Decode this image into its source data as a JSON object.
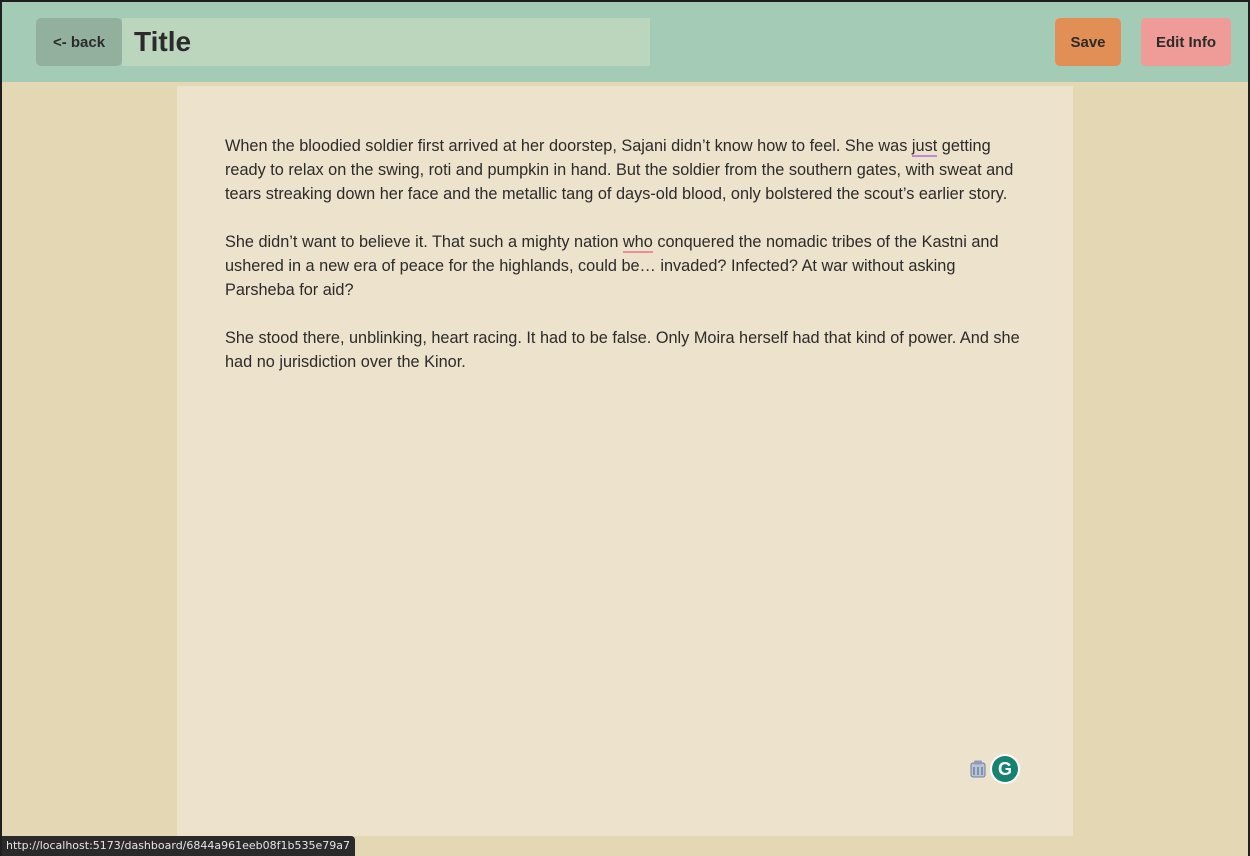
{
  "header": {
    "back_label": "<- back",
    "title_value": "Title",
    "save_label": "Save",
    "edit_info_label": "Edit Info"
  },
  "editor": {
    "p1_a": "When the bloodied soldier first arrived at her doorstep, Sajani didn’t know how to feel. She was ",
    "p1_flag": "just",
    "p1_b": " getting ready to relax on the swing, roti and pumpkin in hand. But the soldier from the southern gates, with sweat and tears streaking down her face and the metallic tang of days-old blood, only bolstered the scout’s earlier story.",
    "p2_a": "She didn’t want to believe it. That such a mighty nation ",
    "p2_flag": "who",
    "p2_b": " conquered the nomadic tribes of the Kastni and ushered in a new era of peace for the highlands, could be… invaded? Infected? At war without asking Parsheba for aid?",
    "p3": "She stood there, unblinking, heart racing. It had to be false. Only Moira herself had that kind of power. And she had no jurisdiction over the Kinor."
  },
  "grammarly": {
    "glyph": "G"
  },
  "status_bar": {
    "url": "http://localhost:5173/dashboard/6844a961eeb08f1b535e79a7"
  },
  "colors": {
    "topbar": "#a4cbb6",
    "page_bg": "#e4d7b3",
    "editor_bg": "#ede2cb",
    "back_button": "#93b09f",
    "title_field": "#bcd5bd",
    "save_button": "#e28f56",
    "edit_button": "#ef9b97",
    "grammarly": "#15836f"
  },
  "icons": [
    "extension-icon",
    "grammarly-icon"
  ]
}
